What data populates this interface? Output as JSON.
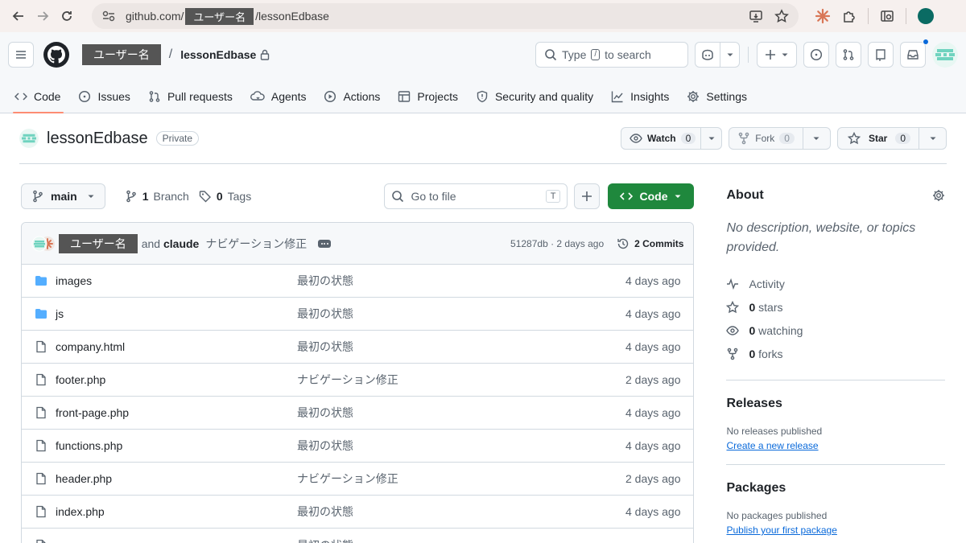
{
  "browser": {
    "url_prefix": "github.com/",
    "url_owner": "ユーザー名",
    "url_suffix": "/lessonEdbase"
  },
  "header": {
    "owner": "ユーザー名",
    "separator": "/",
    "repo": "lessonEdbase",
    "search_label": "Type",
    "search_key": "/",
    "search_suffix": "to search"
  },
  "tabs": [
    {
      "label": "Code",
      "icon": "code-icon"
    },
    {
      "label": "Issues",
      "icon": "issue-icon"
    },
    {
      "label": "Pull requests",
      "icon": "pull-request-icon"
    },
    {
      "label": "Agents",
      "icon": "agents-icon"
    },
    {
      "label": "Actions",
      "icon": "play-icon"
    },
    {
      "label": "Projects",
      "icon": "table-icon"
    },
    {
      "label": "Security and quality",
      "icon": "shield-icon"
    },
    {
      "label": "Insights",
      "icon": "graph-icon"
    },
    {
      "label": "Settings",
      "icon": "gear-icon"
    }
  ],
  "repo": {
    "name": "lessonEdbase",
    "visibility": "Private",
    "watch_label": "Watch",
    "watch_count": "0",
    "fork_label": "Fork",
    "fork_count": "0",
    "star_label": "Star",
    "star_count": "0"
  },
  "toolbar": {
    "branch": "main",
    "branches_count": "1",
    "branches_label": "Branch",
    "tags_count": "0",
    "tags_label": "Tags",
    "goto_placeholder": "Go to file",
    "goto_key": "T",
    "code_label": "Code"
  },
  "commit": {
    "user": "ユーザー名",
    "and": "and",
    "coauthor": "claude",
    "message": "ナビゲーション修正",
    "hash_time": "51287db · 2 days ago",
    "commits_label": "2 Commits"
  },
  "files": [
    {
      "name": "images",
      "type": "folder",
      "message": "最初の状態",
      "date": "4 days ago"
    },
    {
      "name": "js",
      "type": "folder",
      "message": "最初の状態",
      "date": "4 days ago"
    },
    {
      "name": "company.html",
      "type": "file",
      "message": "最初の状態",
      "date": "4 days ago"
    },
    {
      "name": "footer.php",
      "type": "file",
      "message": "ナビゲーション修正",
      "date": "2 days ago"
    },
    {
      "name": "front-page.php",
      "type": "file",
      "message": "最初の状態",
      "date": "4 days ago"
    },
    {
      "name": "functions.php",
      "type": "file",
      "message": "最初の状態",
      "date": "4 days ago"
    },
    {
      "name": "header.php",
      "type": "file",
      "message": "ナビゲーション修正",
      "date": "2 days ago"
    },
    {
      "name": "index.php",
      "type": "file",
      "message": "最初の状態",
      "date": "4 days ago"
    },
    {
      "name": "",
      "type": "file",
      "message": "最初の状態",
      "date": ""
    }
  ],
  "about": {
    "title": "About",
    "description": "No description, website, or topics provided.",
    "activity": "Activity",
    "stars_count": "0",
    "stars_label": "stars",
    "watching_count": "0",
    "watching_label": "watching",
    "forks_count": "0",
    "forks_label": "forks"
  },
  "releases": {
    "title": "Releases",
    "empty": "No releases published",
    "link": "Create a new release"
  },
  "packages": {
    "title": "Packages",
    "empty": "No packages published",
    "link": "Publish your first package"
  },
  "colors": {
    "accent_tab": "#fd8c73",
    "primary_button": "#1f883d",
    "folder": "#54aeff",
    "link": "#0969da"
  }
}
